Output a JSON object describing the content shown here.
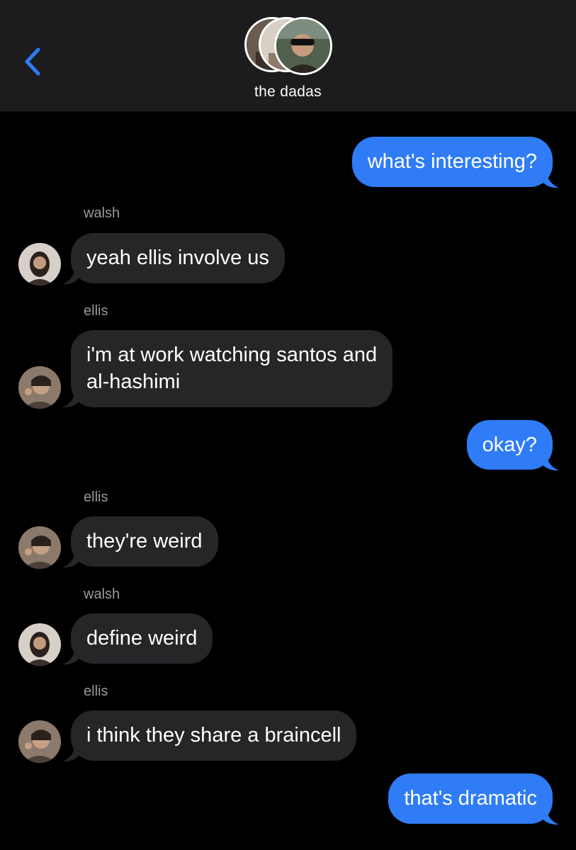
{
  "header": {
    "group_name": "the dadas"
  },
  "messages": [
    {
      "direction": "out",
      "text": "what's interesting?"
    },
    {
      "direction": "in",
      "sender": "walsh",
      "text": "yeah ellis involve us"
    },
    {
      "direction": "in",
      "sender": "ellis",
      "text_lines": [
        "i'm at work watching santos and",
        "al-hashimi"
      ]
    },
    {
      "direction": "out",
      "text": "okay?"
    },
    {
      "direction": "in",
      "sender": "ellis",
      "text": "they're weird"
    },
    {
      "direction": "in",
      "sender": "walsh",
      "text": "define weird"
    },
    {
      "direction": "in",
      "sender": "ellis",
      "text": "i think they share a braincell"
    },
    {
      "direction": "out",
      "text": "that's dramatic"
    }
  ],
  "colors": {
    "outgoing_bubble": "#2f7cf6",
    "incoming_bubble": "#262629",
    "back_chevron": "#2f7cf6",
    "sender_label": "#98989d"
  },
  "icons": {
    "back": "chevron-left-icon"
  }
}
